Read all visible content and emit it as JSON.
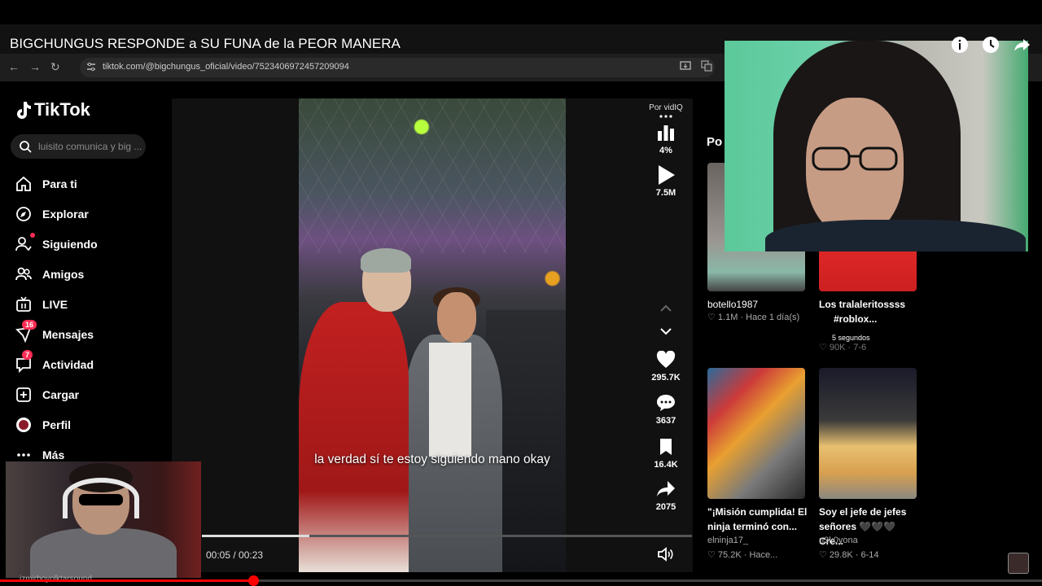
{
  "youtube": {
    "title": "BIGCHUNGUS RESPONDE a SU FUNA de la PEOR MANERA",
    "progress_percent": 24,
    "overlay_caption": "izmirboyolktarsound"
  },
  "browser": {
    "url": "tiktok.com/@bigchungus_oficial/video/7523406972457209094"
  },
  "tiktok": {
    "logo": "TikTok",
    "search_placeholder": "luisito comunica y big ...",
    "nav": [
      {
        "label": "Para ti",
        "icon": "home-icon"
      },
      {
        "label": "Explorar",
        "icon": "compass-icon"
      },
      {
        "label": "Siguiendo",
        "icon": "following-icon"
      },
      {
        "label": "Amigos",
        "icon": "friends-icon"
      },
      {
        "label": "LIVE",
        "icon": "live-icon"
      },
      {
        "label": "Mensajes",
        "icon": "messages-icon",
        "badge": "16"
      },
      {
        "label": "Actividad",
        "icon": "activity-icon",
        "badge": "7"
      },
      {
        "label": "Cargar",
        "icon": "upload-icon"
      },
      {
        "label": "Perfil",
        "icon": "profile-icon"
      },
      {
        "label": "Más",
        "icon": "more-icon"
      }
    ],
    "video": {
      "caption": "la verdad sí te estoy siguiendo mano okay",
      "time": "00:05 / 00:23",
      "progress_fraction": 0.22
    },
    "side_actions": {
      "by_label": "Por vidIQ",
      "stats_pct": "4%",
      "plays": "7.5M",
      "likes": "295.7K",
      "comments": "3637",
      "saves": "16.4K",
      "shares": "2075"
    },
    "section_title": "Po",
    "cards": [
      {
        "title": "botello1987",
        "meta": "♡ 1.1M · Hace 1 día(s)"
      },
      {
        "title": "Los tralaleritossss",
        "subtitle": "#roblox...",
        "meta": "♡ 90K · 7-6",
        "overlay": "5 segundos"
      },
      {
        "title": "\"¡Misión cumplida! El ninja terminó con...",
        "author": "elninja17_",
        "meta": "♡ 75.2K · Hace..."
      },
      {
        "title": "Soy el jefe de jefes señores 🖤🖤🖤 Cre...",
        "author": "n3k0yona",
        "meta": "♡ 29.8K · 6-14"
      }
    ]
  },
  "colors": {
    "accent": "#fe2c55",
    "yt_red": "#ff0000"
  }
}
